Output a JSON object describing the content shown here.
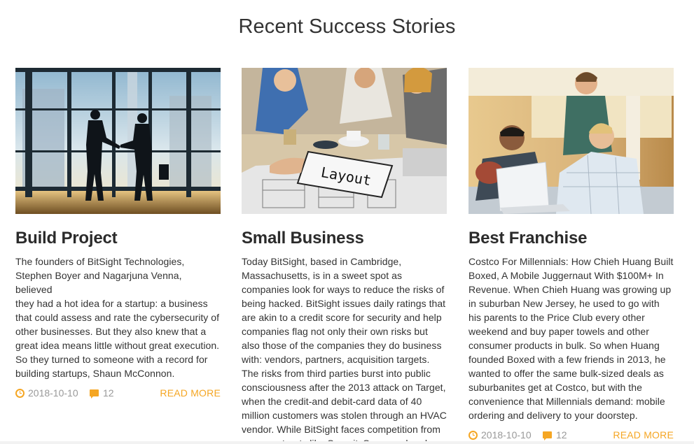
{
  "section": {
    "title": "Recent Success Stories"
  },
  "accent_color": "#f5a623",
  "cards": [
    {
      "image_alt": "Two businessmen shaking hands in front of office windows",
      "title": "Build Project",
      "text": "The founders of BitSight Technologies,\nStephen Boyer and Nagarjuna Venna, believed\nthey had a hot idea for a startup: a business\nthat could assess and rate the cybersecurity of\nother businesses. But they also knew that a\ngreat idea means little without great execution.\nSo they turned to someone with a record for\nbuilding startups, Shaun McConnon.",
      "date": "2018-10-10",
      "comments": "12",
      "read_more": "READ MORE"
    },
    {
      "image_alt": "Team working at a table with a layout sketch",
      "image_text": "Layout",
      "title": "Small Business",
      "text": "Today BitSight, based in Cambridge,\nMassachusetts, is in a sweet spot as\ncompanies look for ways to reduce the risks of\nbeing hacked. BitSight issues daily ratings that\nare akin to a credit score for security and help\ncompanies flag not only their own risks but\nalso those of the companies they do business\nwith: vendors, partners, acquisition targets.\nThe risks from third parties burst into public\nconsciousness after the 2013 attack on Target,\nwhen the credit-and debit-card data of 40\nmillion customers was stolen through an HVAC\nvendor. While BitSight faces competition from\nnewer entrants like SecurityScorecard and"
    },
    {
      "image_alt": "Three young men around a laptop",
      "title": "Best Franchise",
      "text": "Costco For Millennials: How Chieh Huang Built\nBoxed, A Mobile Juggernaut With $100M+ In\nRevenue. When Chieh Huang was growing up\nin suburban New Jersey, he used to go with\nhis parents to the Price Club every other\nweekend and buy paper towels and other\nconsumer products in bulk. So when Huang\nfounded Boxed with a few friends in 2013, he\nwanted to offer the same bulk-sized deals as\nsuburbanites get at Costco, but with the\nconvenience that Millennials demand: mobile\nordering and delivery to your doorstep.",
      "date": "2018-10-10",
      "comments": "12",
      "read_more": "READ MORE"
    }
  ]
}
